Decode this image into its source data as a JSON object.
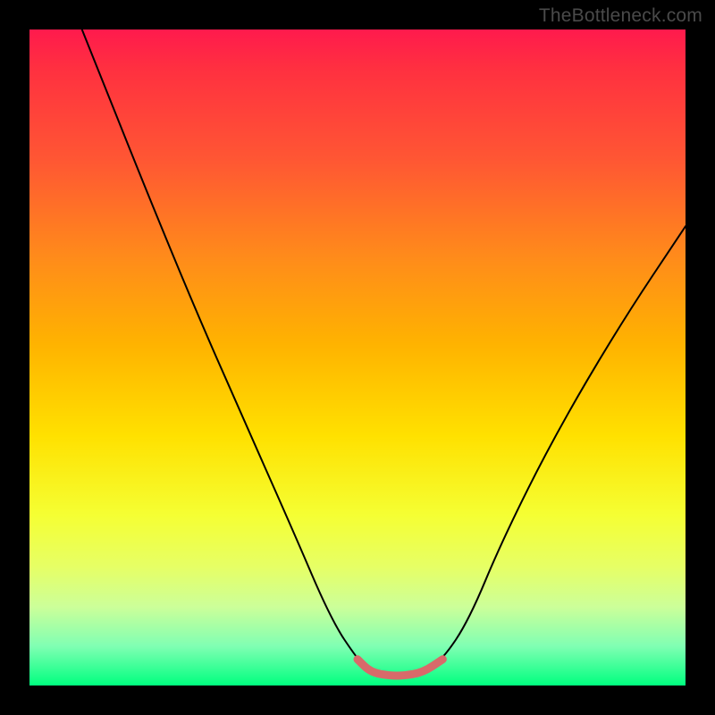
{
  "watermark": "TheBottleneck.com",
  "chart_data": {
    "type": "line",
    "title": "",
    "xlabel": "",
    "ylabel": "",
    "xlim": [
      0,
      100
    ],
    "ylim": [
      0,
      100
    ],
    "series": [
      {
        "name": "curve",
        "x": [
          8,
          12,
          18,
          25,
          32,
          40,
          46,
          50,
          52,
          55,
          57,
          60,
          63,
          67,
          72,
          80,
          90,
          100
        ],
        "values": [
          100,
          90,
          75,
          58,
          42,
          24,
          10,
          4,
          2,
          1.5,
          1.5,
          2,
          4,
          10,
          22,
          38,
          55,
          70
        ]
      }
    ],
    "highlighted_range": {
      "x_start": 50,
      "x_end": 63,
      "color": "#d86a6a"
    }
  },
  "colors": {
    "curve": "#000000",
    "highlight": "#d86a6a",
    "background_top": "#ff1a4d",
    "background_bottom": "#00ff7f",
    "frame": "#000000"
  }
}
